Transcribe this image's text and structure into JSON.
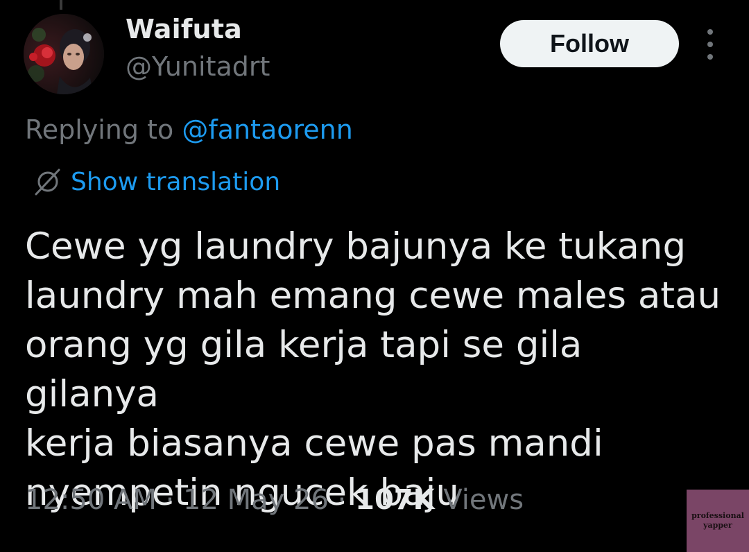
{
  "author": {
    "display_name": "Waifuta",
    "handle": "@Yunitadrt",
    "avatar_icon": "profile-photo"
  },
  "follow": {
    "label": "Follow"
  },
  "more": {
    "icon": "more-vertical-icon"
  },
  "reply": {
    "prefix": "Replying to ",
    "mention": "@fantaorenn"
  },
  "translation": {
    "icon": "globe-icon",
    "label": "Show translation"
  },
  "tweet": {
    "text": "Cewe yg laundry bajunya ke tukang\nlaundry mah emang cewe males atau\norang yg gila kerja tapi se gila gilanya\nkerja biasanya cewe pas mandi\nnyempetin ngucek baju"
  },
  "meta": {
    "time": "12:50 AM",
    "sep1": " · ",
    "date": "12 May 26",
    "sep2": " · ",
    "views_count": "107K",
    "views_label": " Views"
  },
  "watermark": {
    "line1": "professional",
    "line2": "yapper"
  },
  "colors": {
    "background": "#000000",
    "text": "#e7e9ea",
    "secondary": "#71767b",
    "accent": "#1d9bf0",
    "follow_bg": "#eff3f4",
    "watermark_bg": "#7a4566"
  }
}
